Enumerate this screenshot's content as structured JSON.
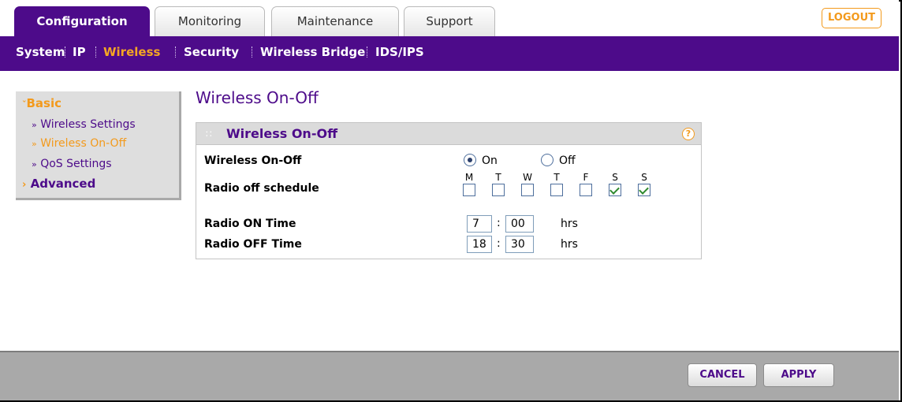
{
  "tabs": [
    {
      "label": "Configuration",
      "active": true
    },
    {
      "label": "Monitoring",
      "active": false
    },
    {
      "label": "Maintenance",
      "active": false
    },
    {
      "label": "Support",
      "active": false
    }
  ],
  "logout_label": "LOGOUT",
  "subnav": [
    {
      "label": "System",
      "active": false
    },
    {
      "label": "IP",
      "active": false
    },
    {
      "label": "Wireless",
      "active": true
    },
    {
      "label": "Security",
      "active": false
    },
    {
      "label": "Wireless Bridge",
      "active": false
    },
    {
      "label": "IDS/IPS",
      "active": false
    }
  ],
  "leftnav": {
    "basic_label": "Basic",
    "items": [
      "Wireless Settings",
      "Wireless On-Off",
      "QoS Settings"
    ],
    "active_item": "Wireless On-Off",
    "advanced_label": "Advanced"
  },
  "page_title": "Wireless On-Off",
  "panel": {
    "title": "Wireless On-Off",
    "help_glyph": "?",
    "wireless_label": "Wireless On-Off",
    "on_label": "On",
    "off_label": "Off",
    "wireless_state": "On",
    "schedule_label": "Radio off schedule",
    "days": [
      {
        "letter": "M",
        "checked": false
      },
      {
        "letter": "T",
        "checked": false
      },
      {
        "letter": "W",
        "checked": false
      },
      {
        "letter": "T",
        "checked": false
      },
      {
        "letter": "F",
        "checked": false
      },
      {
        "letter": "S",
        "checked": true
      },
      {
        "letter": "S",
        "checked": true
      }
    ],
    "on_time_label": "Radio ON Time",
    "on_hour": "7",
    "on_minute": "00",
    "off_time_label": "Radio OFF Time",
    "off_hour": "18",
    "off_minute": "30",
    "colon": ":",
    "hrs_label": "hrs"
  },
  "footer": {
    "cancel_label": "CANCEL",
    "apply_label": "APPLY"
  },
  "colors": {
    "purple": "#4d0b8a",
    "orange": "#f39a1c",
    "footer_gray": "#a9a9a9"
  }
}
